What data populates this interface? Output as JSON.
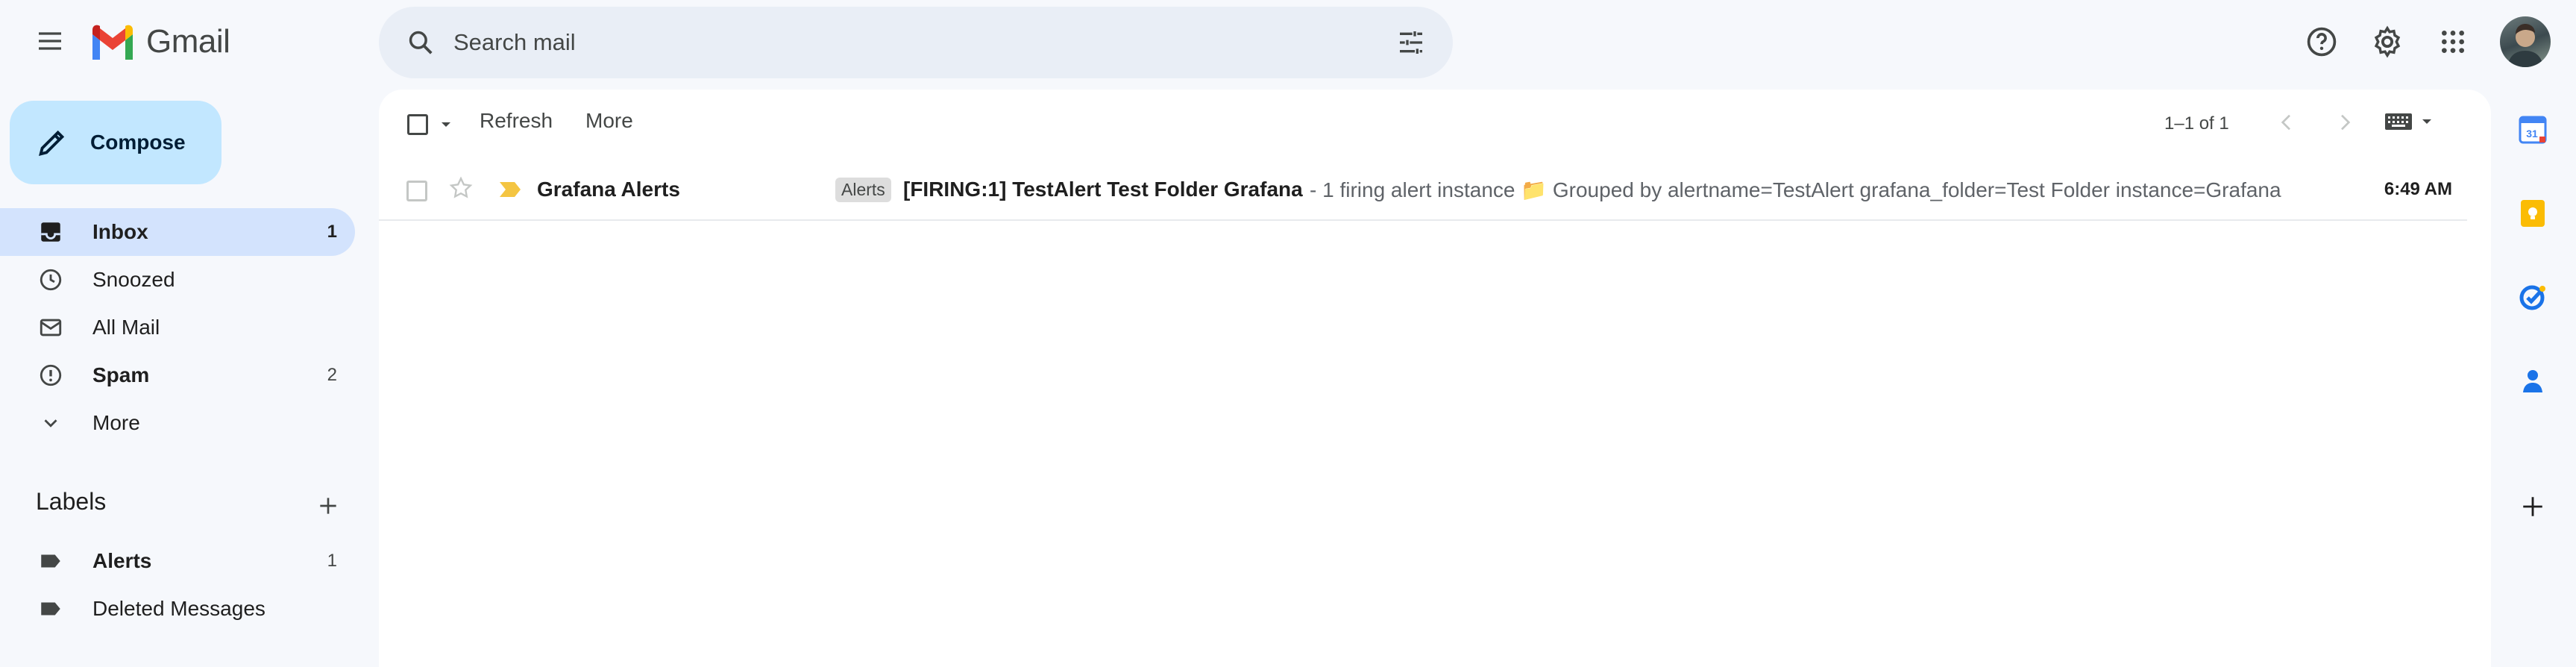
{
  "app": {
    "name": "Gmail"
  },
  "search": {
    "placeholder": "Search mail"
  },
  "compose": {
    "label": "Compose"
  },
  "nav": {
    "items": [
      {
        "label": "Inbox",
        "count": "1",
        "active": true,
        "bold": true
      },
      {
        "label": "Snoozed",
        "count": ""
      },
      {
        "label": "All Mail",
        "count": ""
      },
      {
        "label": "Spam",
        "count": "2",
        "bold": true
      },
      {
        "label": "More",
        "count": ""
      }
    ]
  },
  "labels": {
    "heading": "Labels",
    "items": [
      {
        "label": "Alerts",
        "count": "1",
        "bold": true
      },
      {
        "label": "Deleted Messages",
        "count": ""
      }
    ]
  },
  "toolbar": {
    "refresh": "Refresh",
    "more": "More",
    "pager": "1–1 of 1"
  },
  "emails": [
    {
      "sender": "Grafana Alerts",
      "tag": "Alerts",
      "subject": "[FIRING:1] TestAlert Test Folder Grafana",
      "snippet": "- 1 firing alert instance 📁 Grouped by alertname=TestAlert grafana_folder=Test Folder instance=Grafana",
      "time": "6:49 AM"
    }
  ],
  "side_panel": {
    "calendar_day": "31",
    "icons": [
      "calendar-icon",
      "keep-icon",
      "tasks-icon",
      "contacts-icon",
      "add-icon"
    ]
  },
  "colors": {
    "background": "#f6f8fc",
    "compose": "#c2e7ff",
    "active_nav": "#d3e3fd",
    "gmail_red": "#ea4335",
    "gmail_blue": "#4285f4",
    "gmail_green": "#34a853",
    "gmail_yellow": "#fbbc04"
  }
}
